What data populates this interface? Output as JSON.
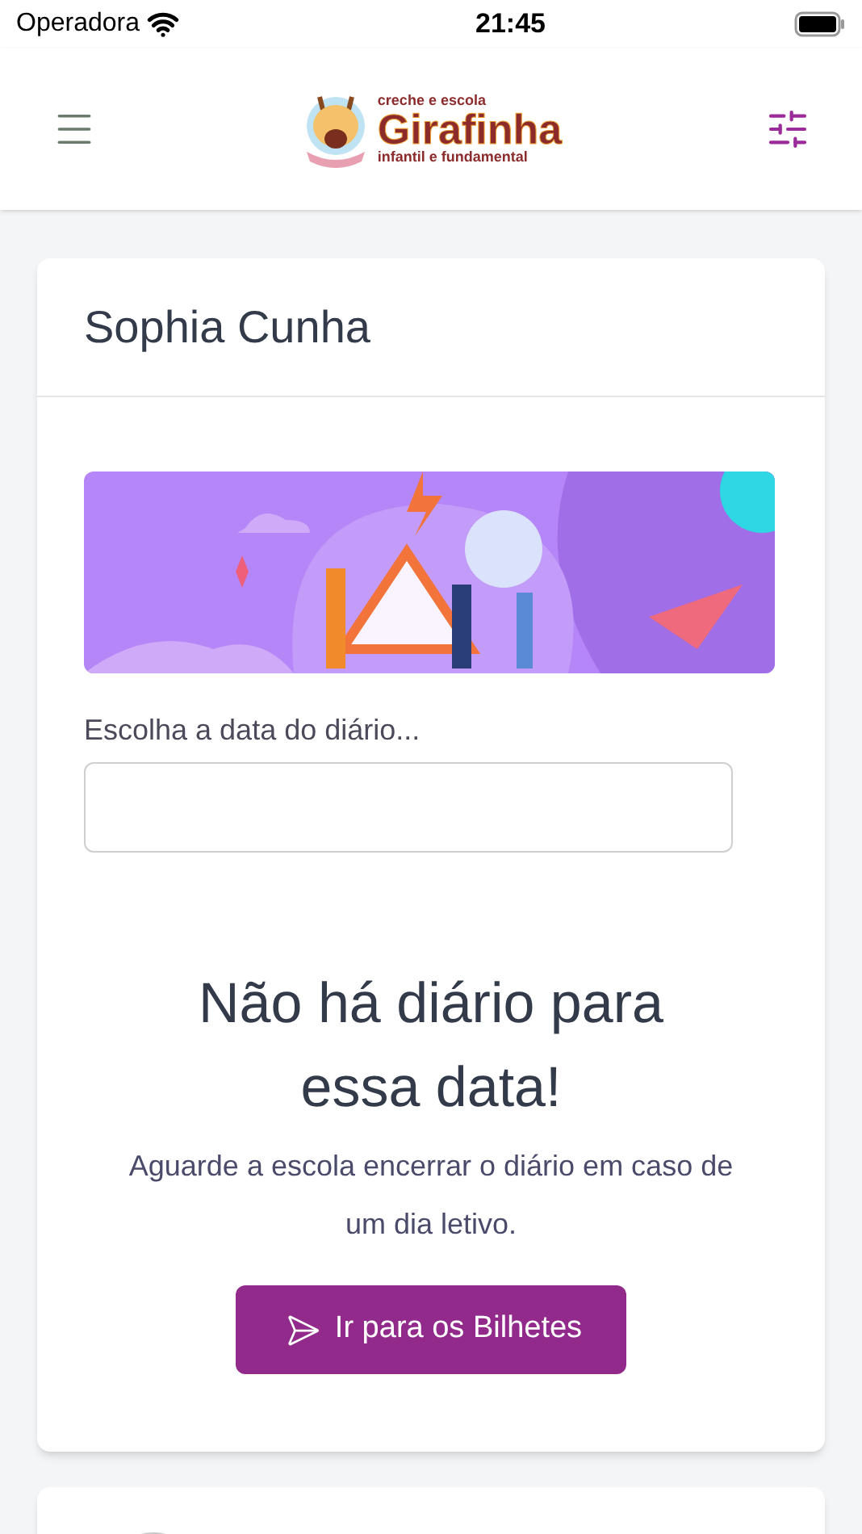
{
  "status_bar": {
    "carrier": "Operadora",
    "time": "21:45"
  },
  "header": {
    "logo": {
      "top": "creche e escola",
      "name": "Girafinha",
      "bottom": "infantil e fundamental"
    }
  },
  "card": {
    "title": "Sophia Cunha",
    "date_field": {
      "label": "Escolha a data do diário..."
    },
    "empty_state": {
      "heading": "Não há diário para essa data!",
      "message": "Aguarde a escola encerrar o diário em caso de um dia letivo.",
      "button": "Ir para os Bilhetes"
    }
  }
}
